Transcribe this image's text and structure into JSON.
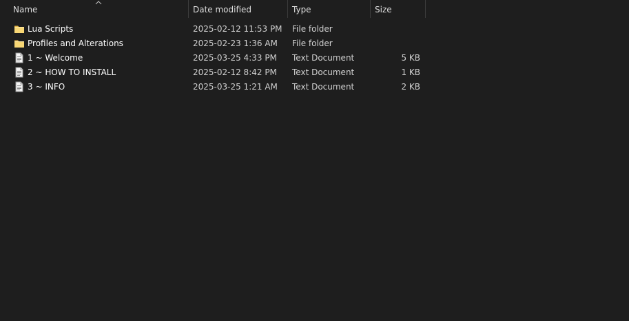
{
  "columns": {
    "name": "Name",
    "date": "Date modified",
    "type": "Type",
    "size": "Size"
  },
  "sort": {
    "column": "name",
    "direction": "ascending"
  },
  "colors": {
    "background": "#1e1e1e",
    "folder": "#f8d775",
    "text": "#ffffff"
  },
  "files": [
    {
      "name": "Lua Scripts",
      "date": "2025-02-12 11:53 PM",
      "type": "File folder",
      "size": "",
      "icon": "folder-icon"
    },
    {
      "name": "Profiles and Alterations",
      "date": "2025-02-23 1:36 AM",
      "type": "File folder",
      "size": "",
      "icon": "folder-icon"
    },
    {
      "name": "1 ~ Welcome",
      "date": "2025-03-25 4:33 PM",
      "type": "Text Document",
      "size": "5 KB",
      "icon": "text-document-icon"
    },
    {
      "name": "2 ~ HOW TO INSTALL",
      "date": "2025-02-12 8:42 PM",
      "type": "Text Document",
      "size": "1 KB",
      "icon": "text-document-icon"
    },
    {
      "name": "3 ~ INFO",
      "date": "2025-03-25 1:21 AM",
      "type": "Text Document",
      "size": "2 KB",
      "icon": "text-document-icon"
    }
  ]
}
